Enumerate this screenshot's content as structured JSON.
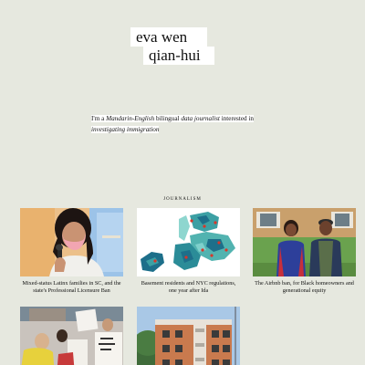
{
  "header": {
    "name_line1": "eva wen",
    "name_line2": "qian-hui"
  },
  "intro": {
    "prefix": "I'm a ",
    "term1": "Mandarin-English",
    "middle1": " bilingual ",
    "term2": "data journalist",
    "middle2": " interested in",
    "term3": "investigating immigration"
  },
  "section": {
    "label": "JOURNALISM"
  },
  "cards": [
    {
      "caption": "Mixed-status Latinx families in SC, and the state's Professional Licensure Ban"
    },
    {
      "caption": "Basement residents and NYC regulations, one year after Ida"
    },
    {
      "caption": "The Airbnb ban, for Black homeowners and generational equity"
    },
    {
      "caption": ""
    },
    {
      "caption": ""
    }
  ],
  "colors": {
    "background": "#e6e8df",
    "highlight": "#ffffff",
    "map_dark": "#1d6f8a",
    "map_light": "#7fd0cc"
  }
}
